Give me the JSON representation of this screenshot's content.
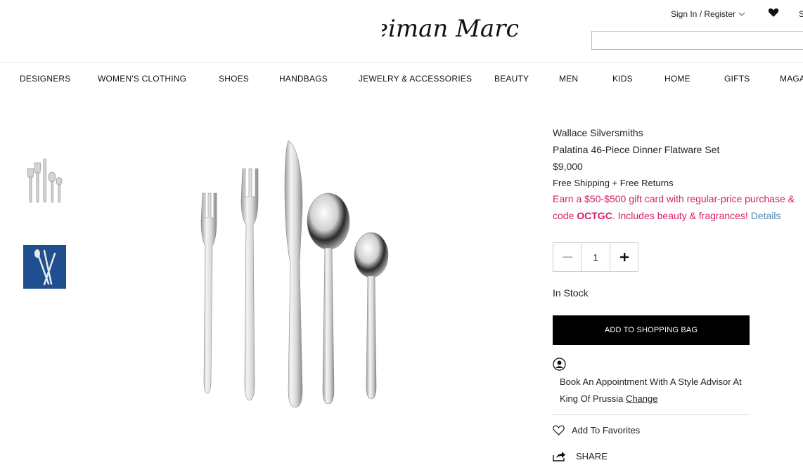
{
  "header": {
    "logo_text": "Neiman Marcus",
    "account_label": "Sign In / Register",
    "cut_label": "S",
    "search_value": ""
  },
  "nav": {
    "items": [
      "DESIGNERS",
      "WOMEN'S CLOTHING",
      "SHOES",
      "HANDBAGS",
      "JEWELRY & ACCESSORIES",
      "BEAUTY",
      "MEN",
      "KIDS",
      "HOME",
      "GIFTS",
      "MAGA"
    ]
  },
  "product": {
    "brand": "Wallace Silversmiths",
    "name": "Palatina 46-Piece Dinner Flatware Set",
    "price": "$9,000",
    "shipping": "Free Shipping + Free Returns",
    "promo_part1": "Earn a $50-$500 gift card with regular-price purchase & code ",
    "promo_code": "OCTGC",
    "promo_part2": ". Includes beauty & fragrances! ",
    "promo_link": "Details",
    "quantity": "1",
    "stock": "In Stock",
    "add_to_bag": "ADD TO SHOPPING BAG",
    "appointment_text": "Book An Appointment With A Style Advisor At King Of Prussia ",
    "appointment_change": "Change",
    "favorites": "Add To Favorites",
    "share": "SHARE"
  },
  "colors": {
    "promo": "#d61e6a",
    "link": "#4f86b8",
    "button": "#000000",
    "thumb_bg": "#1f4f8f"
  },
  "icons": [
    "heart-icon",
    "chevron-down-icon",
    "minus-icon",
    "plus-icon",
    "person-icon",
    "heart-outline-icon",
    "share-icon"
  ]
}
